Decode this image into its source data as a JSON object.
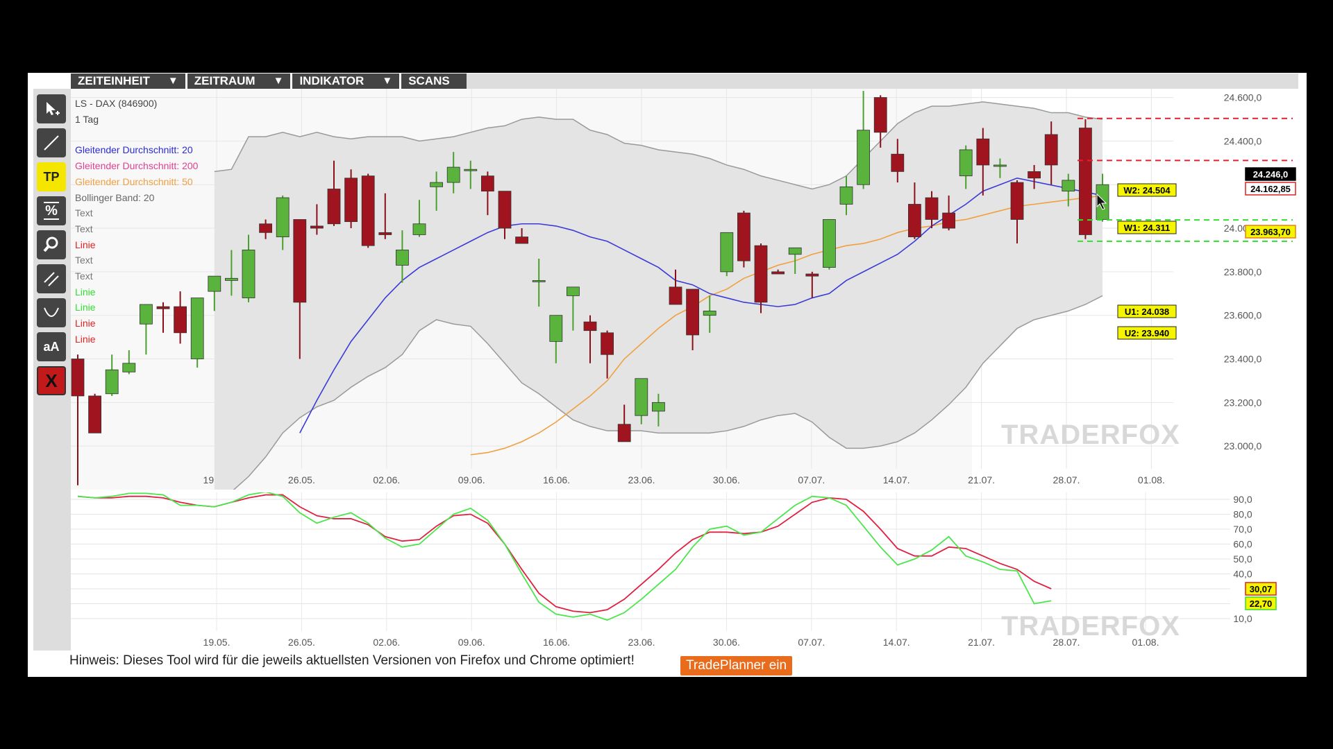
{
  "menu": [
    "ZEITEINHEIT",
    "ZEITRAUM",
    "INDIKATOR",
    "SCANS"
  ],
  "menu_arrow": "▼",
  "tools": {
    "tp": "TP",
    "pct": "%",
    "aa": "aA",
    "x": "X"
  },
  "instrument": {
    "name": "LS - DAX (846900)",
    "timeframe": "1 Tag"
  },
  "legend": [
    {
      "label": "Gleitender Durchschnitt: 20",
      "color": "#2a2ad8"
    },
    {
      "label": "Gleitender Durchschnitt: 200",
      "color": "#e04090"
    },
    {
      "label": "Gleitender Durchschnitt: 50",
      "color": "#f0a040"
    },
    {
      "label": "Bollinger Band: 20",
      "color": "#666666"
    },
    {
      "label": "Text",
      "color": "#777777"
    },
    {
      "label": "Text",
      "color": "#777777"
    },
    {
      "label": "Linie",
      "color": "#e02020"
    },
    {
      "label": "Text",
      "color": "#777777"
    },
    {
      "label": "Text",
      "color": "#777777"
    },
    {
      "label": "Linie",
      "color": "#33dd33"
    },
    {
      "label": "Linie",
      "color": "#33dd33"
    },
    {
      "label": "Linie",
      "color": "#e02020"
    },
    {
      "label": "Linie",
      "color": "#e02020"
    }
  ],
  "watermark": "TRADERFOX",
  "chart_data": [
    {
      "type": "candlestick",
      "title": "LS - DAX (846900)",
      "x_ticks": [
        "19.05.",
        "26.05.",
        "02.06.",
        "09.06.",
        "16.06.",
        "23.06.",
        "30.06.",
        "07.07.",
        "14.07.",
        "21.07.",
        "28.07.",
        "01.08."
      ],
      "y_ticks": [
        "24.600,0",
        "24.400,0",
        "24.000,0",
        "23.800,0",
        "23.600,0",
        "23.400,0",
        "23.200,0",
        "23.000,0"
      ],
      "ylim": [
        22800,
        24640
      ],
      "candles": [
        {
          "o": 23400,
          "h": 23420,
          "l": 22820,
          "c": 23230
        },
        {
          "o": 23230,
          "h": 23240,
          "l": 23100,
          "c": 23060
        },
        {
          "o": 23240,
          "h": 23420,
          "l": 23230,
          "c": 23350
        },
        {
          "o": 23340,
          "h": 23440,
          "l": 23330,
          "c": 23380
        },
        {
          "o": 23560,
          "h": 23600,
          "l": 23420,
          "c": 23650
        },
        {
          "o": 23640,
          "h": 23660,
          "l": 23520,
          "c": 23630
        },
        {
          "o": 23640,
          "h": 23710,
          "l": 23470,
          "c": 23520
        },
        {
          "o": 23400,
          "h": 23680,
          "l": 23360,
          "c": 23680
        },
        {
          "o": 23710,
          "h": 23720,
          "l": 23620,
          "c": 23780
        },
        {
          "o": 23760,
          "h": 23900,
          "l": 23690,
          "c": 23770
        },
        {
          "o": 23680,
          "h": 23970,
          "l": 23660,
          "c": 23900
        },
        {
          "o": 24020,
          "h": 24040,
          "l": 23950,
          "c": 23980
        },
        {
          "o": 23960,
          "h": 24150,
          "l": 23900,
          "c": 24140
        },
        {
          "o": 24040,
          "h": 24040,
          "l": 23400,
          "c": 23660
        },
        {
          "o": 24010,
          "h": 24110,
          "l": 23970,
          "c": 24000
        },
        {
          "o": 24180,
          "h": 24310,
          "l": 24010,
          "c": 24020
        },
        {
          "o": 24230,
          "h": 24270,
          "l": 24000,
          "c": 24030
        },
        {
          "o": 24240,
          "h": 24250,
          "l": 23910,
          "c": 23920
        },
        {
          "o": 23980,
          "h": 24160,
          "l": 23950,
          "c": 23970
        },
        {
          "o": 23830,
          "h": 23990,
          "l": 23750,
          "c": 23900
        },
        {
          "o": 23970,
          "h": 24130,
          "l": 23960,
          "c": 24020
        },
        {
          "o": 24190,
          "h": 24260,
          "l": 24080,
          "c": 24210
        },
        {
          "o": 24210,
          "h": 24350,
          "l": 24160,
          "c": 24280
        },
        {
          "o": 24270,
          "h": 24310,
          "l": 24180,
          "c": 24270
        },
        {
          "o": 24240,
          "h": 24260,
          "l": 24060,
          "c": 24170
        },
        {
          "o": 24170,
          "h": 24170,
          "l": 23950,
          "c": 24000
        },
        {
          "o": 23960,
          "h": 24000,
          "l": 23930,
          "c": 23930
        },
        {
          "o": 23760,
          "h": 23860,
          "l": 23640,
          "c": 23760
        },
        {
          "o": 23480,
          "h": 23560,
          "l": 23380,
          "c": 23600
        },
        {
          "o": 23690,
          "h": 23690,
          "l": 23530,
          "c": 23730
        },
        {
          "o": 23570,
          "h": 23600,
          "l": 23380,
          "c": 23530
        },
        {
          "o": 23520,
          "h": 23530,
          "l": 23310,
          "c": 23420
        },
        {
          "o": 23100,
          "h": 23190,
          "l": 23060,
          "c": 23020
        },
        {
          "o": 23140,
          "h": 23290,
          "l": 23100,
          "c": 23310
        },
        {
          "o": 23160,
          "h": 23240,
          "l": 23090,
          "c": 23200
        },
        {
          "o": 23730,
          "h": 23810,
          "l": 23690,
          "c": 23650
        },
        {
          "o": 23720,
          "h": 23720,
          "l": 23440,
          "c": 23510
        },
        {
          "o": 23600,
          "h": 23690,
          "l": 23520,
          "c": 23620
        },
        {
          "o": 23800,
          "h": 23840,
          "l": 23780,
          "c": 23980
        },
        {
          "o": 24070,
          "h": 24080,
          "l": 23820,
          "c": 23850
        },
        {
          "o": 23920,
          "h": 23930,
          "l": 23610,
          "c": 23660
        },
        {
          "o": 23800,
          "h": 23810,
          "l": 23800,
          "c": 23790
        },
        {
          "o": 23880,
          "h": 23910,
          "l": 23790,
          "c": 23910
        },
        {
          "o": 23790,
          "h": 23800,
          "l": 23680,
          "c": 23780
        },
        {
          "o": 23820,
          "h": 24040,
          "l": 23810,
          "c": 24040
        },
        {
          "o": 24110,
          "h": 24240,
          "l": 24060,
          "c": 24190
        },
        {
          "o": 24200,
          "h": 24630,
          "l": 24180,
          "c": 24450
        },
        {
          "o": 24600,
          "h": 24610,
          "l": 24370,
          "c": 24440
        },
        {
          "o": 24340,
          "h": 24410,
          "l": 24210,
          "c": 24260
        },
        {
          "o": 24110,
          "h": 24210,
          "l": 23950,
          "c": 23960
        },
        {
          "o": 24140,
          "h": 24170,
          "l": 24000,
          "c": 24040
        },
        {
          "o": 24070,
          "h": 24150,
          "l": 23990,
          "c": 24000
        },
        {
          "o": 24240,
          "h": 24380,
          "l": 24180,
          "c": 24360
        },
        {
          "o": 24410,
          "h": 24460,
          "l": 24150,
          "c": 24290
        },
        {
          "o": 24290,
          "h": 24320,
          "l": 24230,
          "c": 24290
        },
        {
          "o": 24210,
          "h": 24220,
          "l": 23930,
          "c": 24040
        },
        {
          "o": 24260,
          "h": 24290,
          "l": 24180,
          "c": 24230
        },
        {
          "o": 24430,
          "h": 24490,
          "l": 24200,
          "c": 24290
        },
        {
          "o": 24170,
          "h": 24250,
          "l": 24100,
          "c": 24220
        },
        {
          "o": 24460,
          "h": 24500,
          "l": 23950,
          "c": 23970
        },
        {
          "o": 24040,
          "h": 24250,
          "l": 24030,
          "c": 24200
        }
      ],
      "ma20": [
        null,
        null,
        null,
        null,
        null,
        null,
        null,
        null,
        null,
        null,
        null,
        null,
        null,
        23060,
        23210,
        23350,
        23480,
        23580,
        23680,
        23760,
        23820,
        23860,
        23900,
        23940,
        23980,
        24010,
        24020,
        24020,
        24010,
        23990,
        23960,
        23940,
        23900,
        23860,
        23820,
        23760,
        23740,
        23700,
        23680,
        23660,
        23650,
        23640,
        23650,
        23680,
        23700,
        23760,
        23800,
        23840,
        23880,
        23940,
        24010,
        24060,
        24110,
        24170,
        24200,
        24230,
        null,
        null,
        null,
        null,
        24150
      ],
      "ma50": [
        null,
        null,
        null,
        null,
        null,
        null,
        null,
        null,
        null,
        null,
        null,
        null,
        null,
        null,
        null,
        null,
        null,
        null,
        null,
        null,
        null,
        null,
        null,
        22960,
        22970,
        22990,
        23020,
        23060,
        23110,
        23170,
        23230,
        23300,
        23400,
        23470,
        23540,
        23600,
        23640,
        23690,
        23720,
        23770,
        23800,
        23830,
        23850,
        23880,
        23900,
        23920,
        23930,
        23950,
        23980,
        24000,
        24010,
        24030,
        24040,
        24060,
        24080,
        24100,
        24110,
        24120,
        24130,
        24140,
        24150
      ],
      "bb_upper": [
        null,
        null,
        null,
        null,
        null,
        null,
        null,
        null,
        24260,
        24270,
        24420,
        24420,
        24440,
        24420,
        24440,
        24420,
        24410,
        24420,
        24420,
        24420,
        24400,
        24410,
        24420,
        24440,
        24460,
        24470,
        24500,
        24510,
        24500,
        24500,
        24450,
        24430,
        24390,
        24380,
        24360,
        24350,
        24340,
        24320,
        24290,
        24270,
        24240,
        24220,
        24200,
        24180,
        24200,
        24240,
        24320,
        24400,
        24480,
        24530,
        24560,
        24560,
        24570,
        24580,
        24570,
        24560,
        24550,
        24530,
        24530,
        24510,
        24500
      ],
      "bb_lower": [
        null,
        null,
        null,
        null,
        null,
        null,
        null,
        null,
        22690,
        22790,
        22860,
        22950,
        23060,
        23130,
        23180,
        23210,
        23270,
        23320,
        23360,
        23420,
        23530,
        23580,
        23560,
        23550,
        23470,
        23380,
        23290,
        23240,
        23180,
        23120,
        23090,
        23070,
        23070,
        23070,
        23060,
        23060,
        23060,
        23060,
        23070,
        23090,
        23120,
        23140,
        23150,
        23110,
        23040,
        22990,
        22990,
        23000,
        23020,
        23060,
        23120,
        23190,
        23270,
        23380,
        23460,
        23540,
        23580,
        23600,
        23620,
        23650,
        23690
      ],
      "hlines": [
        {
          "label": "W2: 24.504",
          "value": 24504,
          "color": "#e0202c"
        },
        {
          "label": "W1: 24.311",
          "value": 24311,
          "color": "#e0202c"
        },
        {
          "label": "U1: 24.038",
          "value": 24038,
          "color": "#33dd33"
        },
        {
          "label": "U2: 23.940",
          "value": 23940,
          "color": "#33dd33"
        }
      ],
      "price_tags": [
        {
          "label": "24.246,0",
          "value": 24246,
          "bg": "#000000",
          "fg": "#ffffff",
          "border": "#000000"
        },
        {
          "label": "24.162,85",
          "value": 24162.85,
          "bg": "#ffffff",
          "fg": "#000000",
          "border": "#e02020"
        },
        {
          "label": "23.963,70",
          "value": 23963.7,
          "bg": "#f5f500",
          "fg": "#000000",
          "border": "#e08020"
        }
      ]
    },
    {
      "type": "line",
      "x_ticks": [
        "19.05.",
        "26.05.",
        "02.06.",
        "09.06.",
        "16.06.",
        "23.06.",
        "30.06.",
        "07.07.",
        "14.07.",
        "21.07.",
        "28.07.",
        "01.08."
      ],
      "y_ticks": [
        "90,0",
        "80,0",
        "70,0",
        "60,0",
        "50,0",
        "40,0",
        "10,0"
      ],
      "ylim": [
        0,
        100
      ],
      "series": [
        {
          "color": "#e02040",
          "values": [
            92,
            91,
            91,
            92,
            92,
            91,
            88,
            86,
            85,
            88,
            91,
            93,
            93,
            85,
            79,
            77,
            77,
            73,
            65,
            62,
            63,
            72,
            79,
            80,
            74,
            60,
            43,
            27,
            18,
            15,
            14,
            16,
            23,
            33,
            43,
            54,
            63,
            68,
            68,
            67,
            68,
            72,
            80,
            88,
            91,
            90,
            82,
            70,
            57,
            52,
            52,
            58,
            57,
            52,
            47,
            43,
            35,
            30
          ]
        },
        {
          "color": "#4ae64a",
          "values": [
            92,
            91,
            92,
            94,
            94,
            93,
            86,
            86,
            85,
            88,
            93,
            95,
            92,
            81,
            74,
            78,
            81,
            74,
            64,
            58,
            60,
            70,
            80,
            84,
            76,
            60,
            40,
            21,
            13,
            11,
            13,
            9,
            14,
            23,
            33,
            43,
            58,
            70,
            72,
            66,
            68,
            77,
            86,
            92,
            91,
            86,
            72,
            58,
            46,
            50,
            56,
            65,
            52,
            48,
            43,
            42,
            20,
            22
          ]
        }
      ],
      "last_tags": [
        {
          "label": "30,07",
          "bg": "#f5f500",
          "border": "#e02020"
        },
        {
          "label": "22,70",
          "bg": "#f5f500",
          "border": "#33dd33"
        }
      ]
    }
  ],
  "footer": {
    "note": "Hinweis: Dieses Tool wird für die jeweils aktuellsten Versionen von Firefox und Chrome optimiert!",
    "button": "TradePlanner ein"
  }
}
